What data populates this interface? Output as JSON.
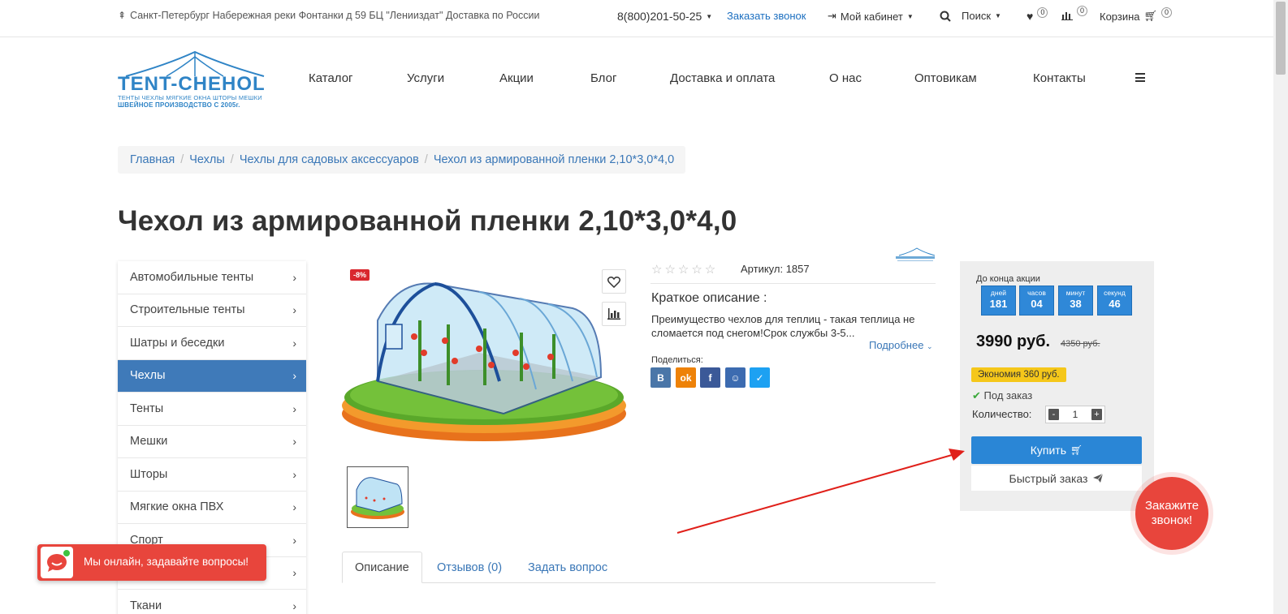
{
  "topbar": {
    "address": "Санкт-Петербург Набережная реки Фонтанки д 59 БЦ \"Ленииздат\" Доставка по России",
    "phone": "8(800)201-50-25",
    "callback_link": "Заказать звонок",
    "cabinet": "Мой кабинет",
    "search": "Поиск",
    "favorites_count": "0",
    "compare_count": "0",
    "cart_label": "Корзина",
    "cart_count": "0"
  },
  "logo": {
    "title": "TENT-CHEHOL",
    "line1": "ТЕНТЫ  ЧЕХЛЫ  МЯГКИЕ ОКНА  ШТОРЫ  МЕШКИ",
    "line2": "ШВЕЙНОЕ ПРОИЗВОДСТВО С 2005г."
  },
  "nav": {
    "items": [
      "Каталог",
      "Услуги",
      "Акции",
      "Блог",
      "Доставка и оплата",
      "О нас",
      "Оптовикам",
      "Контакты"
    ]
  },
  "breadcrumb": [
    "Главная",
    "Чехлы",
    "Чехлы для садовых аксессуаров",
    "Чехол из армированной пленки 2,10*3,0*4,0"
  ],
  "product": {
    "title": "Чехол из армированной пленки 2,10*3,0*4,0",
    "discount_badge": "-8%",
    "stars": "☆☆☆☆☆",
    "sku": "Артикул: 1857",
    "short_title": "Краткое описание :",
    "short_text": "Преимущество чехлов для теплиц - такая теплица не сломается под снегом!Срок службы 3-5...",
    "more": "Подробнее",
    "share_label": "Поделиться:"
  },
  "sidebar": {
    "items": [
      "Автомобильные тенты",
      "Строительные тенты",
      "Шатры и беседки",
      "Чехлы",
      "Тенты",
      "Мешки",
      "Шторы",
      "Мягкие окна ПВХ",
      "Спорт",
      "",
      "Ткани"
    ],
    "active_index": 3
  },
  "tabs": [
    "Описание",
    "Отзывов (0)",
    "Задать вопрос"
  ],
  "buybox": {
    "promo_label": "До конца акции",
    "timer": [
      {
        "unit": "дней",
        "value": "181"
      },
      {
        "unit": "часов",
        "value": "04"
      },
      {
        "unit": "минут",
        "value": "38"
      },
      {
        "unit": "секунд",
        "value": "46"
      }
    ],
    "price": "3990 руб.",
    "old_price": "4350 руб.",
    "economy": "Экономия 360 руб.",
    "availability": "Под заказ",
    "qty_label": "Количество:",
    "qty_value": "1",
    "buy_label": "Купить",
    "fast_label": "Быстрый заказ"
  },
  "callback_bubble": "Закажите звонок!",
  "chat": "Мы онлайн, задавайте вопросы!",
  "colors": {
    "accent": "#3f7ab9",
    "buy_button": "#2a86d6",
    "timer": "#2f88d8",
    "badge": "#d9272e",
    "economy": "#f5c71a",
    "callback": "#e8453c"
  }
}
